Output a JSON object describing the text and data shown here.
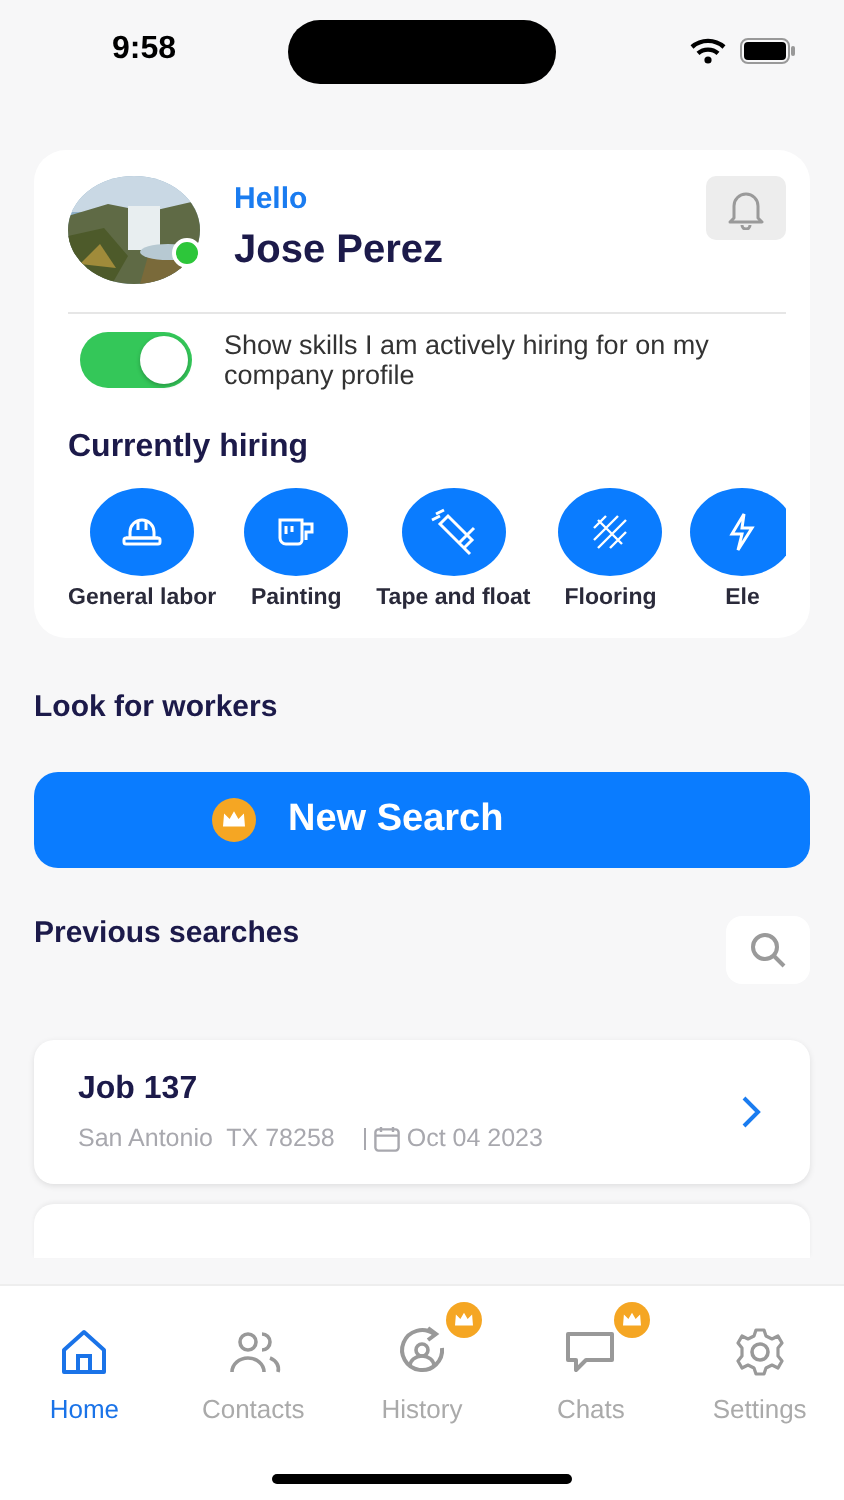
{
  "status_bar": {
    "time": "9:58"
  },
  "profile": {
    "greeting": "Hello",
    "name": "Jose Perez",
    "online": true
  },
  "hiring_toggle": {
    "label": "Show skills I am actively hiring for on my company profile",
    "on": true
  },
  "currently_hiring": {
    "title": "Currently hiring",
    "skills": [
      {
        "label": "General labor",
        "kind": "helmet"
      },
      {
        "label": "Painting",
        "kind": "paint"
      },
      {
        "label": "Tape and float",
        "kind": "trowel"
      },
      {
        "label": "Flooring",
        "kind": "floor"
      },
      {
        "label": "Ele",
        "kind": "electric"
      }
    ]
  },
  "look_for_workers": {
    "title": "Look for workers",
    "button": "New Search"
  },
  "previous_searches": {
    "title": "Previous searches",
    "items": [
      {
        "title": "Job 137",
        "location": "San Antonio  TX 78258",
        "date": "Oct 04 2023"
      }
    ]
  },
  "tab_bar": [
    {
      "label": "Home",
      "kind": "home",
      "selected": true,
      "premium": false
    },
    {
      "label": "Contacts",
      "kind": "contacts",
      "selected": false,
      "premium": false
    },
    {
      "label": "History",
      "kind": "history",
      "selected": false,
      "premium": true
    },
    {
      "label": "Chats",
      "kind": "chats",
      "selected": false,
      "premium": true
    },
    {
      "label": "Settings",
      "kind": "settings",
      "selected": false,
      "premium": false
    }
  ]
}
